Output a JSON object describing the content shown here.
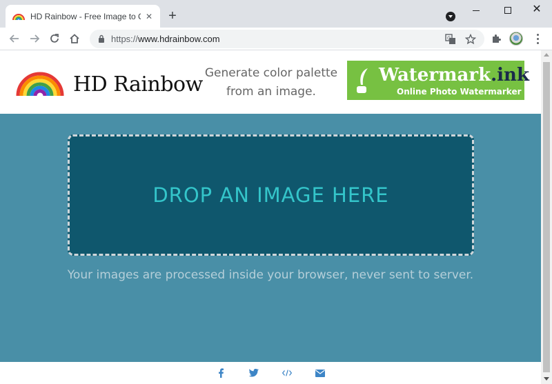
{
  "browser": {
    "tab": {
      "title": "HD Rainbow - Free Image to Color Palette",
      "favicon": "rainbow-icon",
      "close_label": "✕"
    },
    "new_tab_label": "+",
    "url_protocol": "https://",
    "url_host": "www.hdrainbow.com",
    "icons": [
      "back-arrow-icon",
      "forward-arrow-icon",
      "reload-icon",
      "home-icon",
      "lock-icon",
      "translate-icon",
      "star-icon",
      "puzzle-icon",
      "menu-dots-icon"
    ]
  },
  "header": {
    "logo_text": "HD Rainbow",
    "tagline_line1": "Generate color palette",
    "tagline_line2": "from an image.",
    "ad": {
      "title_main": "Watermark",
      "title_ext": ".ink",
      "subtitle": "Online Photo Watermarker",
      "background": "#77c142"
    }
  },
  "main": {
    "drop_label": "DROP AN IMAGE HERE",
    "privacy_note": "Your images are processed inside your browser, never sent to server.",
    "background": "#498fa7",
    "dropzone_background": "#0f576d",
    "drop_label_color": "#34c5ca"
  },
  "footer": {
    "icons": [
      "facebook-icon",
      "twitter-icon",
      "code-icon",
      "envelope-icon"
    ],
    "icon_color": "#3d85c6"
  }
}
